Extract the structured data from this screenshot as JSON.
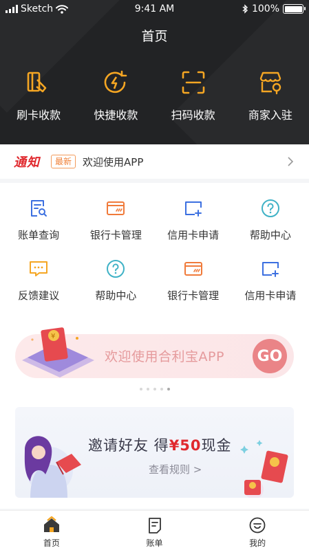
{
  "status_bar": {
    "carrier": "Sketch",
    "time": "9:41 AM",
    "battery": "100%"
  },
  "header": {
    "title": "首页"
  },
  "top_actions": [
    {
      "label": "刷卡收款",
      "icon": "card-swipe-icon"
    },
    {
      "label": "快捷收款",
      "icon": "quick-pay-icon"
    },
    {
      "label": "扫码收款",
      "icon": "scan-icon"
    },
    {
      "label": "商家入驻",
      "icon": "store-icon"
    }
  ],
  "notice": {
    "logo": "通知",
    "badge": "最新",
    "text": "欢迎使用APP"
  },
  "menu": [
    {
      "label": "账单查询",
      "icon": "bill-search-icon"
    },
    {
      "label": "银行卡管理",
      "icon": "bank-card-icon"
    },
    {
      "label": "信用卡申请",
      "icon": "credit-card-add-icon"
    },
    {
      "label": "帮助中心",
      "icon": "help-icon"
    },
    {
      "label": "反馈建议",
      "icon": "feedback-icon"
    },
    {
      "label": "帮助中心",
      "icon": "help-icon"
    },
    {
      "label": "银行卡管理",
      "icon": "bank-card-icon"
    },
    {
      "label": "信用卡申请",
      "icon": "credit-card-add-icon"
    }
  ],
  "banner": {
    "text": "欢迎使用合利宝APP",
    "button": "GO",
    "active_dot": 4,
    "dot_count": 5
  },
  "invite": {
    "title_prefix": "邀请好友 得",
    "amount": "¥50",
    "title_suffix": "现金",
    "rule_link": "查看规则 >"
  },
  "tabbar": [
    {
      "label": "首页",
      "icon": "home-icon",
      "active": true
    },
    {
      "label": "账单",
      "icon": "bill-icon",
      "active": false
    },
    {
      "label": "我的",
      "icon": "profile-icon",
      "active": false
    }
  ],
  "colors": {
    "accent": "#f5a623",
    "header_bg": "#222325",
    "red": "#e0292e",
    "blue": "#3b6fe0",
    "orange": "#f07a3a",
    "teal": "#3fb2c6"
  }
}
